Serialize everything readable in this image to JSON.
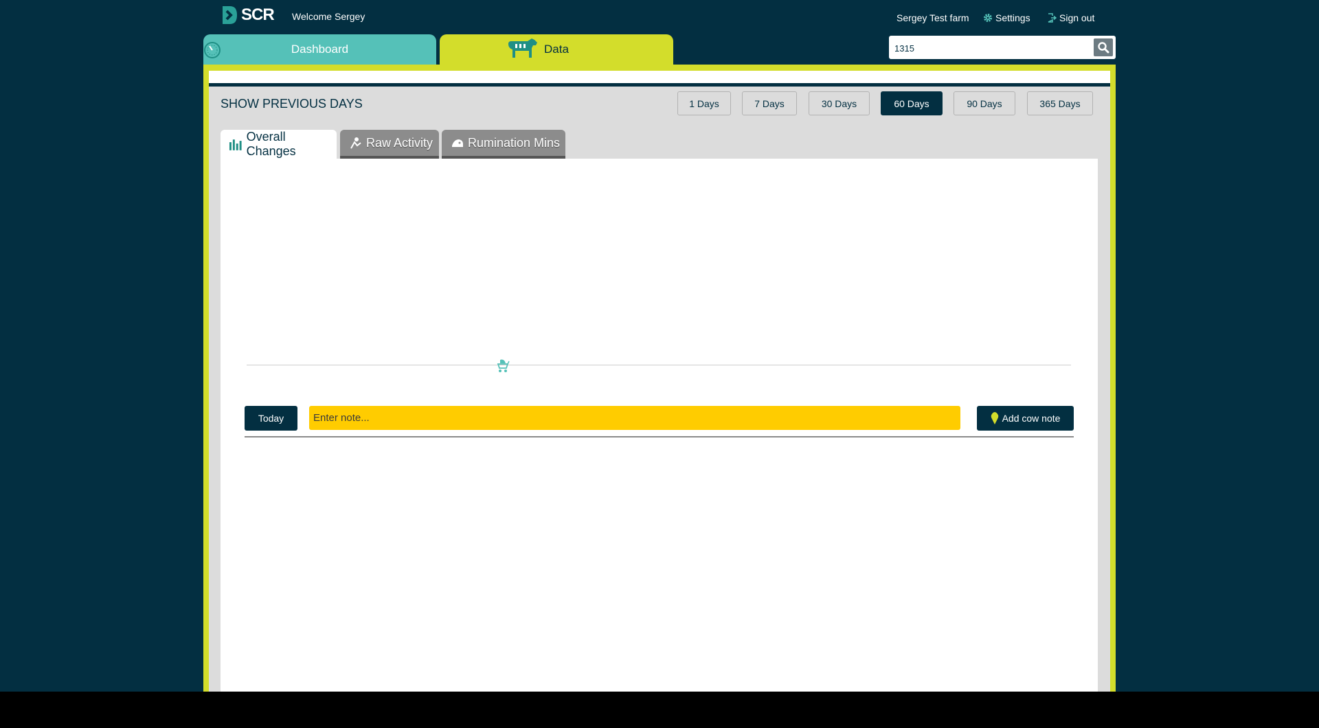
{
  "header": {
    "brand": "SCR",
    "welcome": "Welcome Sergey",
    "farm_name": "Sergey Test farm",
    "settings_label": "Settings",
    "signout_label": "Sign out"
  },
  "nav_tabs": [
    {
      "label": "Dashboard",
      "icon": "gauge-icon",
      "color": "#55c1b8"
    },
    {
      "label": "Data",
      "icon": "cow-icon",
      "color": "#d3dd2b",
      "active": true
    }
  ],
  "search": {
    "value": "1315",
    "icon": "search-icon"
  },
  "period": {
    "label": "SHOW PREVIOUS DAYS",
    "options": [
      "1 Days",
      "7 Days",
      "30 Days",
      "60 Days",
      "90 Days",
      "365 Days"
    ],
    "selected": "60 Days"
  },
  "subtabs": [
    {
      "label": "Overall Changes",
      "icon": "bar-chart-icon",
      "active": true
    },
    {
      "label": "Raw Activity",
      "icon": "activity-icon"
    },
    {
      "label": "Rumination Mins",
      "icon": "rumination-icon"
    }
  ],
  "timeline": {
    "event_icon": "stroller-icon"
  },
  "notes": {
    "today_label": "Today",
    "placeholder": "Enter note...",
    "add_label": "Add cow note",
    "add_icon": "map-pin-icon"
  },
  "colors": {
    "background": "#032f41",
    "dashboard_tab": "#55c1b8",
    "data_tab": "#d3dd2b",
    "note_input": "#ffcc00",
    "button_dark": "#032f41"
  }
}
